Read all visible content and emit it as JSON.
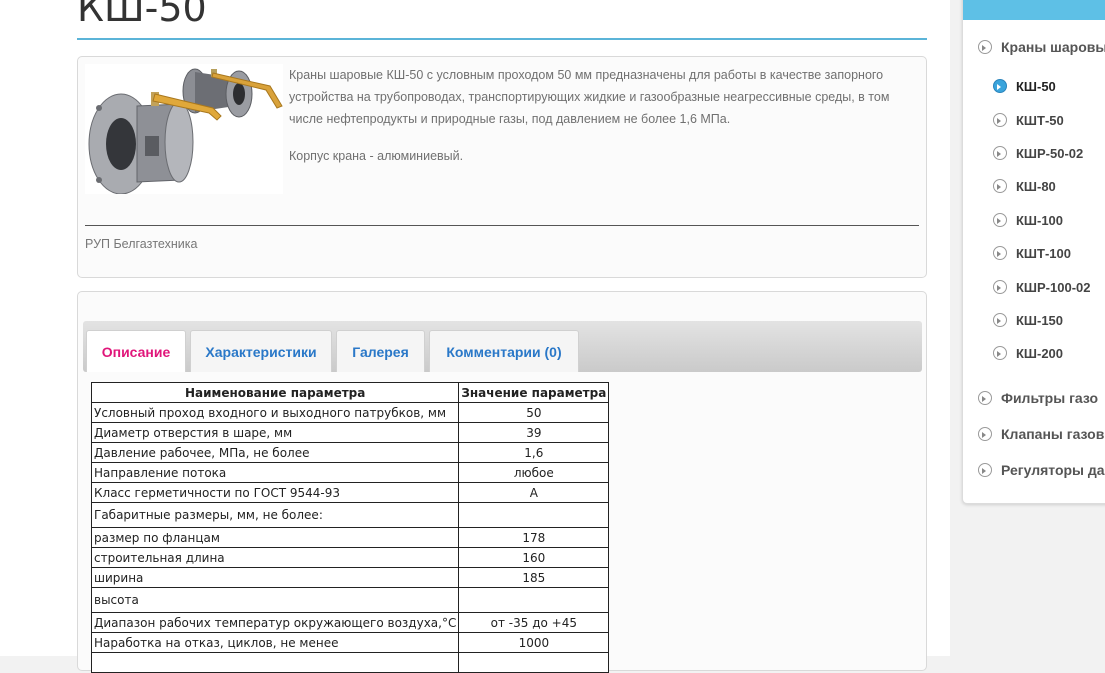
{
  "page": {
    "title": "КШ-50"
  },
  "intro": {
    "description": "Краны шаровые КШ-50 с условным проходом 50 мм предназначены для работы в качестве запорного устройства на трубопроводах, транспортирующих жидкие и газообразные неагрессивные среды, в том числе нефтепродукты и природные газы, под давлением не более 1,6 МПа.",
    "body_note": "Корпус крана - алюминиевый.",
    "manufacturer": "РУП Белгазтехника"
  },
  "tabs": [
    {
      "label": "Описание",
      "active": true
    },
    {
      "label": "Характеристики",
      "active": false
    },
    {
      "label": "Галерея",
      "active": false
    },
    {
      "label": "Комментарии (0)",
      "active": false
    }
  ],
  "params_table": {
    "headers": [
      "Наименование параметра",
      "Значение параметра"
    ],
    "rows": [
      [
        "Условный проход входного и выходного патрубков, мм",
        "50"
      ],
      [
        "Диаметр отверстия в шаре, мм",
        "39"
      ],
      [
        "Давление рабочее, МПа, не более",
        "1,6"
      ],
      [
        "Направление потока",
        "любое"
      ],
      [
        "Класс герметичности по ГОСТ 9544-93",
        "А"
      ],
      [
        "Габаритные размеры, мм, не более:",
        ""
      ],
      [
        "размер по фланцам",
        "178"
      ],
      [
        "строительная длина",
        "160"
      ],
      [
        "ширина",
        "185"
      ],
      [
        "высота",
        ""
      ],
      [
        "Диапазон рабочих температур окружающего воздуха,°С",
        "от -35 до +45"
      ],
      [
        "Наработка на отказ, циклов, не менее",
        "1000"
      ],
      [
        "",
        ""
      ]
    ]
  },
  "sidebar": {
    "category_current": "Краны шаровы",
    "subitems": [
      {
        "label": "КШ-50",
        "current": true
      },
      {
        "label": "КШТ-50",
        "current": false
      },
      {
        "label": "КШР-50-02",
        "current": false
      },
      {
        "label": "КШ-80",
        "current": false
      },
      {
        "label": "КШ-100",
        "current": false
      },
      {
        "label": "КШТ-100",
        "current": false
      },
      {
        "label": "КШР-100-02",
        "current": false
      },
      {
        "label": "КШ-150",
        "current": false
      },
      {
        "label": "КШ-200",
        "current": false
      }
    ],
    "categories_other": [
      "Фильтры газо",
      "Клапаны газов",
      "Регуляторы да"
    ]
  },
  "colors": {
    "accent_blue": "#5bb4d8",
    "tab_link": "#2a78c8",
    "tab_active": "#e0167a",
    "sidebar_header": "#5ec0e6"
  }
}
